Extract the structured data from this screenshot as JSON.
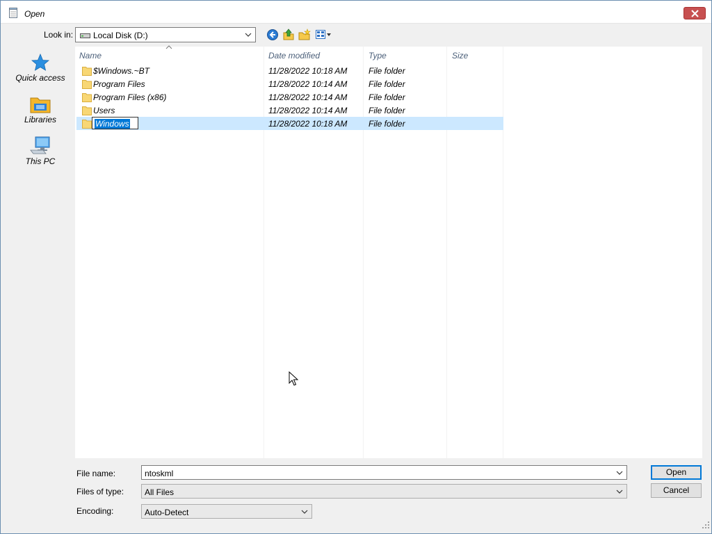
{
  "window": {
    "title": "Open"
  },
  "toolbar": {
    "lookin_label": "Look in:",
    "lookin_value": "Local Disk (D:)"
  },
  "places": [
    {
      "label": "Quick access",
      "icon": "star-icon"
    },
    {
      "label": "Libraries",
      "icon": "libraries-folder-icon"
    },
    {
      "label": "This PC",
      "icon": "computer-icon"
    }
  ],
  "filelist": {
    "columns": [
      "Name",
      "Date modified",
      "Type",
      "Size"
    ],
    "rows": [
      {
        "name": "$Windows.~BT",
        "date": "11/28/2022 10:18 AM",
        "type": "File folder"
      },
      {
        "name": "Program Files",
        "date": "11/28/2022 10:14 AM",
        "type": "File folder"
      },
      {
        "name": "Program Files (x86)",
        "date": "11/28/2022 10:14 AM",
        "type": "File folder"
      },
      {
        "name": "Users",
        "date": "11/28/2022 10:14 AM",
        "type": "File folder"
      },
      {
        "name": "Windows",
        "date": "11/28/2022 10:18 AM",
        "type": "File folder"
      }
    ]
  },
  "form": {
    "filename_label": "File name:",
    "filename_value": "ntoskml",
    "filetype_label": "Files of type:",
    "filetype_value": "All Files",
    "encoding_label": "Encoding:",
    "encoding_value": "Auto-Detect"
  },
  "buttons": {
    "open": "Open",
    "cancel": "Cancel"
  },
  "colors": {
    "selection": "#cce8ff",
    "highlight": "#0078d7",
    "close": "#c75050"
  }
}
